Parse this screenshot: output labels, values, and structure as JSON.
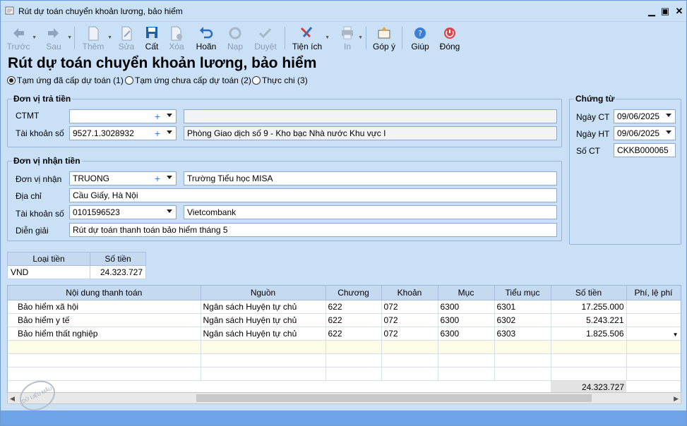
{
  "window": {
    "title": "Rút dự toán chuyển khoản lương, bảo hiểm"
  },
  "toolbar": {
    "prev": "Trước",
    "next": "Sau",
    "add": "Thêm",
    "edit": "Sửa",
    "save": "Cất",
    "delete": "Xóa",
    "undo": "Hoãn",
    "load": "Nạp",
    "approve": "Duyệt",
    "utilities": "Tiện ích",
    "print": "In",
    "feedback": "Góp ý",
    "help": "Giúp",
    "close": "Đóng"
  },
  "heading": "Rút dự toán chuyển khoản lương, bảo hiểm",
  "radios": [
    {
      "label": "Tạm ứng đã cấp dự toán (1)",
      "checked": true
    },
    {
      "label": "Tạm ứng chưa cấp dự toán (2)",
      "checked": false
    },
    {
      "label": "Thực chi (3)",
      "checked": false
    }
  ],
  "payer": {
    "legend": "Đơn vị trả tiền",
    "ctmt_label": "CTMT",
    "ctmt_value": "",
    "ctmt_desc": "",
    "account_label": "Tài khoản số",
    "account_value": "9527.1.3028932",
    "account_desc": "Phòng Giao dịch số 9 - Kho bạc Nhà nước Khu vực I"
  },
  "payee": {
    "legend": "Đơn vị nhận tiền",
    "unit_label": "Đơn vị nhận",
    "unit_value": "TRUONG",
    "unit_desc": "Trường Tiểu học MISA",
    "address_label": "Địa chỉ",
    "address_value": "Cầu Giấy, Hà Nội",
    "account_label": "Tài khoản số",
    "account_value": "0101596523",
    "bank_value": "Vietcombank",
    "desc_label": "Diễn giải",
    "desc_value": "Rút dự toán thanh toán bảo hiểm tháng 5"
  },
  "voucher": {
    "legend": "Chứng từ",
    "date_ct_label": "Ngày CT",
    "date_ct": "09/06/2025",
    "date_ht_label": "Ngày HT",
    "date_ht": "09/06/2025",
    "no_label": "Số CT",
    "no_value": "CKKB000065"
  },
  "currency": {
    "headers": [
      "Loại tiền",
      "Số tiền"
    ],
    "rows": [
      {
        "type": "VND",
        "amount": "24.323.727"
      }
    ]
  },
  "grid": {
    "headers": [
      "Nội dung thanh toán",
      "Nguồn",
      "Chương",
      "Khoản",
      "Mục",
      "Tiểu mục",
      "Số tiền",
      "Phí, lệ phí"
    ],
    "rows": [
      {
        "content": "Bảo hiểm xã hội",
        "source": "Ngân sách Huyện tự chủ",
        "chapter": "622",
        "section": "072",
        "item": "6300",
        "subitem": "6301",
        "amount": "17.255.000",
        "fee": ""
      },
      {
        "content": "Bảo hiểm y tế",
        "source": "Ngân sách Huyện tự chủ",
        "chapter": "622",
        "section": "072",
        "item": "6300",
        "subitem": "6302",
        "amount": "5.243.221",
        "fee": ""
      },
      {
        "content": "Bảo hiểm thất nghiệp",
        "source": "Ngân sách Huyện tự chủ",
        "chapter": "622",
        "section": "072",
        "item": "6300",
        "subitem": "6303",
        "amount": "1.825.506",
        "fee": ""
      }
    ],
    "total": "24.323.727"
  },
  "stamp_text": "DỮ LIỆU MẪU"
}
